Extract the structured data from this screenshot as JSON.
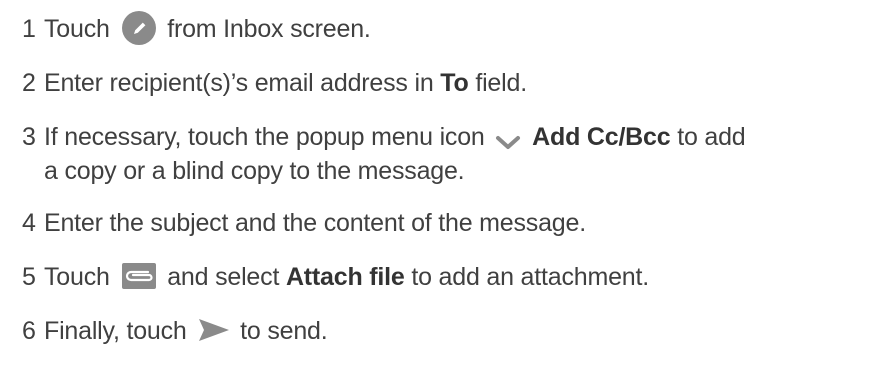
{
  "steps": [
    {
      "num": "1",
      "pre": "Touch",
      "post": "from Inbox screen.",
      "icon": "compose-pencil-icon"
    },
    {
      "num": "2",
      "pre": "Enter recipient(s)’s email address in",
      "bold": "To",
      "post": "field."
    },
    {
      "num": "3",
      "pre": "If necessary, touch the popup menu icon",
      "bold": "Add Cc/Bcc",
      "post": "to add",
      "line2": "a copy or a blind copy to the message.",
      "icon": "chevron-down-icon"
    },
    {
      "num": "4",
      "text": "Enter the subject and the content of the message."
    },
    {
      "num": "5",
      "pre": "Touch",
      "mid": "and select",
      "bold": "Attach file",
      "post": "to add an attachment.",
      "icon": "paperclip-icon"
    },
    {
      "num": "6",
      "pre": "Finally, touch",
      "post": "to send.",
      "icon": "send-icon"
    }
  ],
  "colors": {
    "text": "#404040",
    "icon_gray": "#8a8a8a"
  }
}
